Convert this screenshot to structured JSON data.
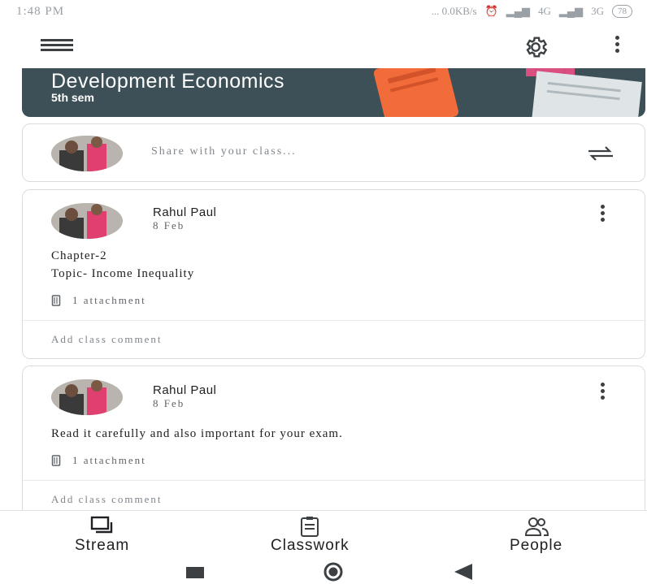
{
  "status_bar": {
    "time": "1:48 PM",
    "indicators": "... 0.0KB/s",
    "network_1": "4G",
    "network_2": "3G",
    "battery": "78"
  },
  "app_bar": {
    "menu_icon": "hamburger-menu-icon",
    "settings_icon": "gear-icon",
    "more_icon": "more-vertical-icon"
  },
  "banner": {
    "title": "Development Economics",
    "subtitle": "5th sem"
  },
  "share": {
    "placeholder": "Share with your class..."
  },
  "posts": [
    {
      "author": "Rahul Paul",
      "date": "8 Feb",
      "body_lines": [
        "Chapter-2",
        "Topic- Income Inequality"
      ],
      "attachments": "1 attachment",
      "comment_placeholder": "Add class comment"
    },
    {
      "author": "Rahul Paul",
      "date": "8 Feb",
      "body_lines": [
        "Read it carefully and also important for your exam."
      ],
      "attachments": "1 attachment",
      "comment_placeholder": "Add class comment"
    }
  ],
  "bottom_nav": {
    "items": [
      {
        "label": "Stream",
        "icon": "stream-icon",
        "active": true
      },
      {
        "label": "Classwork",
        "icon": "clipboard-icon",
        "active": false
      },
      {
        "label": "People",
        "icon": "people-icon",
        "active": false
      }
    ]
  },
  "colors": {
    "banner": "#3d5057",
    "accent_orange": "#f26b3a",
    "text": "#202124"
  }
}
